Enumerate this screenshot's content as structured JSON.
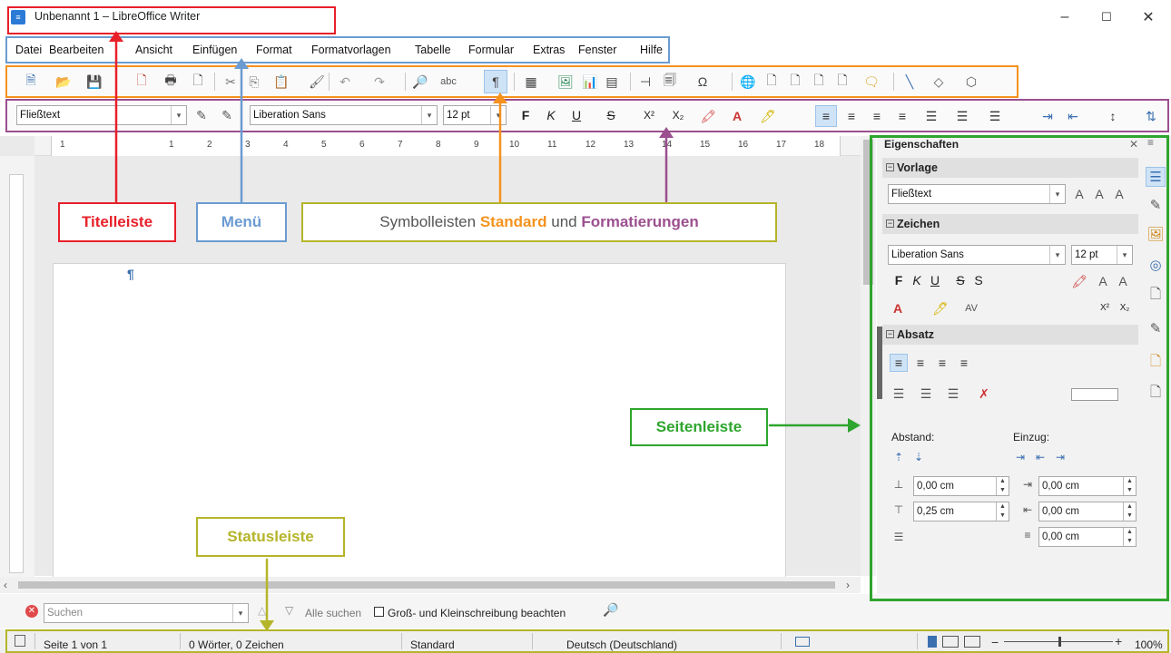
{
  "window": {
    "title": "Unbenannt 1 – LibreOffice Writer",
    "app_icon": "writer-icon",
    "controls": [
      "–",
      "☐",
      "✕"
    ]
  },
  "menu": [
    "Datei",
    "Bearbeiten",
    "Ansicht",
    "Einfügen",
    "Format",
    "Formatvorlagen",
    "Tabelle",
    "Formular",
    "Extras",
    "Fenster",
    "Hilfe"
  ],
  "formatting": {
    "style": "Fließtext",
    "font": "Liberation Sans",
    "size": "12 pt",
    "bold": "F",
    "italic": "K",
    "underline": "U",
    "strike": "S",
    "superscript": "X²",
    "subscript": "X₂"
  },
  "ruler": {
    "numbers": [
      "1",
      "1",
      "2",
      "3",
      "4",
      "5",
      "6",
      "7",
      "8",
      "9",
      "10",
      "11",
      "12",
      "13",
      "14",
      "15",
      "16",
      "17",
      "18"
    ]
  },
  "document": {
    "pilcrow": "¶"
  },
  "sidebar": {
    "title": "Eigenschaften",
    "vorlage": {
      "header": "Vorlage",
      "style": "Fließtext"
    },
    "zeichen": {
      "header": "Zeichen",
      "font": "Liberation Sans",
      "size": "12 pt",
      "fmt_bold": "F",
      "fmt_italic": "K",
      "fmt_underline": "U",
      "fmt_strike": "S",
      "fmt_shadow": "S",
      "sup": "X²",
      "sub": "X₂"
    },
    "absatz": {
      "header": "Absatz"
    },
    "abstand_label": "Abstand:",
    "einzug_label": "Einzug:",
    "abstand_values": [
      "0,00 cm",
      "0,25 cm"
    ],
    "einzug_values": [
      "0,00 cm",
      "0,00 cm",
      "0,00 cm"
    ]
  },
  "find": {
    "placeholder": "Suchen",
    "find_all": "Alle suchen",
    "match_case": "Groß- und Kleinschreibung beachten"
  },
  "status": {
    "page": "Seite 1 von 1",
    "words": "0 Wörter, 0 Zeichen",
    "style": "Standard",
    "language": "Deutsch (Deutschland)",
    "zoom": "100%"
  },
  "annotations": {
    "titelleiste": "Titelleiste",
    "menue": "Menü",
    "symbol_prefix": "Symbolleisten ",
    "symbol_standard": "Standard",
    "symbol_und": " und ",
    "symbol_format": "Formatierungen",
    "seitenleiste": "Seitenleiste",
    "statusleiste": "Statusleiste",
    "colors": {
      "red": "#e8202a",
      "blue": "#6b9bd1",
      "orange": "#f5921e",
      "purple": "#9b4f8f",
      "green": "#2ea52e",
      "olive": "#b5b52a"
    }
  }
}
